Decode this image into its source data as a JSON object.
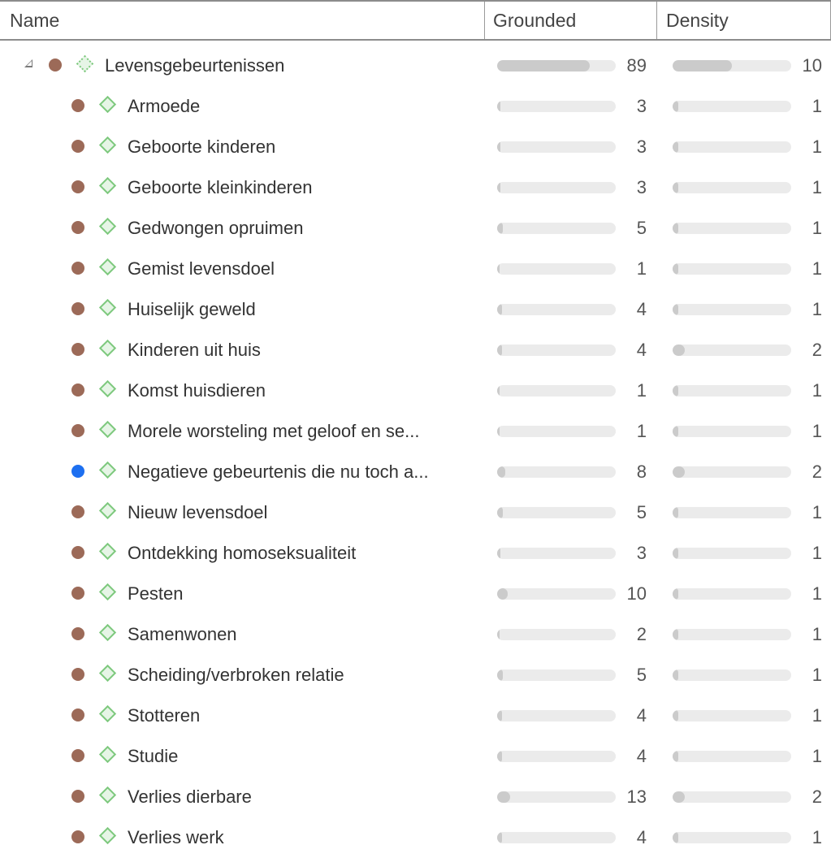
{
  "columns": {
    "name": "Name",
    "grounded": "Grounded",
    "density": "Density"
  },
  "colors": {
    "dot_default": "#9c6a58",
    "dot_highlight": "#1d6ff0",
    "diamond": "#7ec97e"
  },
  "rows": [
    {
      "level": 0,
      "expanded": true,
      "dot": "brown",
      "label": "Levensgebeurtenissen",
      "grounded": 89,
      "grounded_fill": 0.78,
      "density": 10,
      "density_fill": 0.5
    },
    {
      "level": 1,
      "dot": "brown",
      "label": "Armoede",
      "grounded": 3,
      "grounded_fill": 0.03,
      "density": 1,
      "density_fill": 0.05
    },
    {
      "level": 1,
      "dot": "brown",
      "label": "Geboorte kinderen",
      "grounded": 3,
      "grounded_fill": 0.03,
      "density": 1,
      "density_fill": 0.05
    },
    {
      "level": 1,
      "dot": "brown",
      "label": "Geboorte kleinkinderen",
      "grounded": 3,
      "grounded_fill": 0.03,
      "density": 1,
      "density_fill": 0.05
    },
    {
      "level": 1,
      "dot": "brown",
      "label": "Gedwongen opruimen",
      "grounded": 5,
      "grounded_fill": 0.05,
      "density": 1,
      "density_fill": 0.05
    },
    {
      "level": 1,
      "dot": "brown",
      "label": "Gemist levensdoel",
      "grounded": 1,
      "grounded_fill": 0.015,
      "density": 1,
      "density_fill": 0.05
    },
    {
      "level": 1,
      "dot": "brown",
      "label": "Huiselijk geweld",
      "grounded": 4,
      "grounded_fill": 0.04,
      "density": 1,
      "density_fill": 0.05
    },
    {
      "level": 1,
      "dot": "brown",
      "label": "Kinderen uit huis",
      "grounded": 4,
      "grounded_fill": 0.04,
      "density": 2,
      "density_fill": 0.1
    },
    {
      "level": 1,
      "dot": "brown",
      "label": "Komst huisdieren",
      "grounded": 1,
      "grounded_fill": 0.015,
      "density": 1,
      "density_fill": 0.05
    },
    {
      "level": 1,
      "dot": "brown",
      "label": "Morele worsteling met geloof en se...",
      "grounded": 1,
      "grounded_fill": 0.015,
      "density": 1,
      "density_fill": 0.05
    },
    {
      "level": 1,
      "dot": "blue",
      "label": "Negatieve gebeurtenis die nu toch a...",
      "grounded": 8,
      "grounded_fill": 0.07,
      "density": 2,
      "density_fill": 0.1
    },
    {
      "level": 1,
      "dot": "brown",
      "label": "Nieuw levensdoel",
      "grounded": 5,
      "grounded_fill": 0.05,
      "density": 1,
      "density_fill": 0.05
    },
    {
      "level": 1,
      "dot": "brown",
      "label": "Ontdekking homoseksualiteit",
      "grounded": 3,
      "grounded_fill": 0.03,
      "density": 1,
      "density_fill": 0.05
    },
    {
      "level": 1,
      "dot": "brown",
      "label": "Pesten",
      "grounded": 10,
      "grounded_fill": 0.09,
      "density": 1,
      "density_fill": 0.05
    },
    {
      "level": 1,
      "dot": "brown",
      "label": "Samenwonen",
      "grounded": 2,
      "grounded_fill": 0.02,
      "density": 1,
      "density_fill": 0.05
    },
    {
      "level": 1,
      "dot": "brown",
      "label": "Scheiding/verbroken relatie",
      "grounded": 5,
      "grounded_fill": 0.05,
      "density": 1,
      "density_fill": 0.05
    },
    {
      "level": 1,
      "dot": "brown",
      "label": "Stotteren",
      "grounded": 4,
      "grounded_fill": 0.04,
      "density": 1,
      "density_fill": 0.05
    },
    {
      "level": 1,
      "dot": "brown",
      "label": "Studie",
      "grounded": 4,
      "grounded_fill": 0.04,
      "density": 1,
      "density_fill": 0.05
    },
    {
      "level": 1,
      "dot": "brown",
      "label": "Verlies dierbare",
      "grounded": 13,
      "grounded_fill": 0.11,
      "density": 2,
      "density_fill": 0.1
    },
    {
      "level": 1,
      "dot": "brown",
      "label": "Verlies werk",
      "grounded": 4,
      "grounded_fill": 0.04,
      "density": 1,
      "density_fill": 0.05
    }
  ]
}
